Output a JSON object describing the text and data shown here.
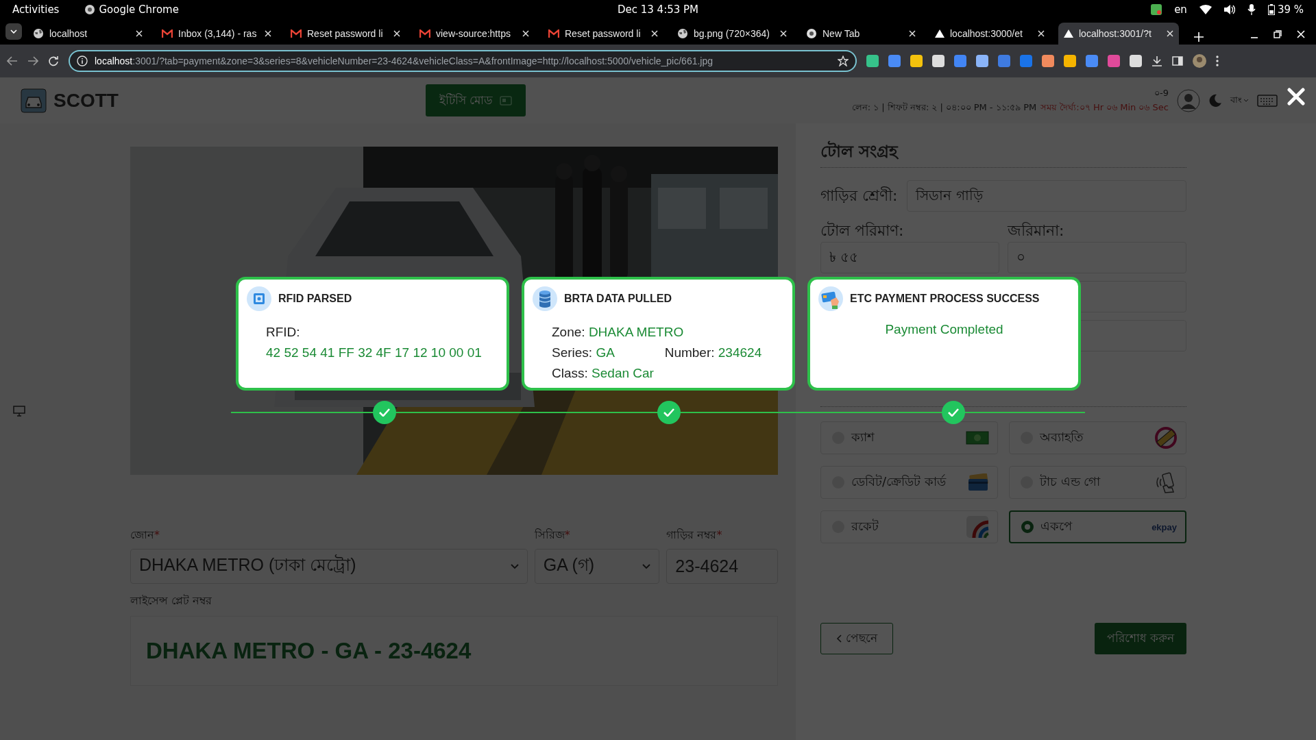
{
  "system_bar": {
    "activities": "Activities",
    "app": "Google Chrome",
    "clock": "Dec 13  4:53 PM",
    "language": "en",
    "battery": "39 %"
  },
  "browser": {
    "tabs": [
      {
        "title": "localhost",
        "kind": "globe",
        "selected": false
      },
      {
        "title": "Inbox (3,144) - ras",
        "kind": "mail",
        "selected": false
      },
      {
        "title": "Reset password li",
        "kind": "mail",
        "selected": false
      },
      {
        "title": "view-source:https",
        "kind": "mail",
        "selected": false
      },
      {
        "title": "Reset password li",
        "kind": "mail",
        "selected": false
      },
      {
        "title": "bg.png (720×364)",
        "kind": "globe",
        "selected": false
      },
      {
        "title": "New Tab",
        "kind": "chrome",
        "selected": false
      },
      {
        "title": "localhost:3000/et",
        "kind": "triangle",
        "selected": false
      },
      {
        "title": "localhost:3001/?t",
        "kind": "triangle",
        "selected": true
      }
    ],
    "address": {
      "host": "localhost",
      "path": ":3001/?tab=payment&zone=3&series=8&vehicleNumber=23-4624&vehicleClass=A&frontImage=http://localhost:5000/vehicle_pic/661.jpg"
    }
  },
  "header": {
    "logo": "SCOTT",
    "mode_button": "ইটিসি মোড",
    "shift_code": "০-9",
    "shift_info": "লেন: ১ |  শিফট নম্বর: ২ | ০৪:০০ PM - ১১:৫৯ PM",
    "duration": "সময় দৈর্ঘ্য:০৭ Hr ০৬ Min ০৬ Sec",
    "language": "বাং"
  },
  "vehicle_form": {
    "fields": [
      {
        "label": "জোন",
        "required_mark": "*",
        "value": "DHAKA METRO (ঢাকা মেট্রো)",
        "kind": "select"
      },
      {
        "label": "সিরিজ",
        "required_mark": "*",
        "value": "GA (গ)",
        "kind": "select"
      },
      {
        "label": "গাড়ির নম্বর",
        "required_mark": "*",
        "value": "23-4624",
        "kind": "input"
      }
    ],
    "plate": {
      "label": "লাইসেন্স প্লেট নম্বর",
      "value": "DHAKA METRO - GA - 23-4624"
    }
  },
  "toll_panel": {
    "title": "টোল সংগ্রহ",
    "vehicle_class": {
      "label": "গাড়ির শ্রেণী:",
      "value": "সিডান গাড়ি"
    },
    "toll": {
      "label": "টোল পরিমাণ:",
      "value": "৳ ৫৫"
    },
    "fine": {
      "label": "জরিমানা:",
      "value": "০"
    },
    "payment_methods": [
      {
        "label": "ক্যাশ",
        "kind": "cash",
        "selected": false
      },
      {
        "label": "অব্যাহতি",
        "kind": "exempt",
        "selected": false
      },
      {
        "label": "ডেবিট/ক্রেডিট কার্ড",
        "kind": "card",
        "selected": false
      },
      {
        "label": "টাচ এন্ড গো",
        "kind": "touch",
        "selected": false
      },
      {
        "label": "রকেট",
        "kind": "rocket",
        "selected": false
      },
      {
        "label": "একপে",
        "kind": "ekpay",
        "logo_text": "ekpay",
        "selected": true
      }
    ],
    "back_button": "পেছনে",
    "pay_button": "পরিশোধ করুন"
  },
  "process_cards": [
    {
      "kind": "rfid",
      "title": "RFID PARSED",
      "completed": true,
      "label": "RFID:",
      "value": "42 52 54 41 FF 32 4F 17 12 10 00 01"
    },
    {
      "kind": "brta",
      "title": "BRTA DATA PULLED",
      "completed": true,
      "fields": [
        {
          "label": "Zone:",
          "value": "DHAKA METRO"
        },
        {
          "label": "Series:",
          "value": "GA"
        },
        {
          "label": "Number:",
          "value": "234624"
        },
        {
          "label": "Class:",
          "value": "Sedan Car"
        }
      ]
    },
    {
      "kind": "status",
      "title": "ETC PAYMENT PROCESS SUCCESS",
      "completed": true,
      "message": "Payment Completed"
    }
  ]
}
